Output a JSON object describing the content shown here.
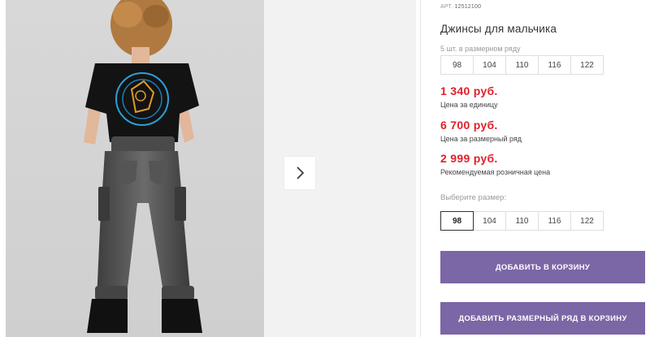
{
  "product": {
    "article_label": "АРТ.",
    "article_value": "12512100",
    "title": "Джинсы для мальчика",
    "size_set_hint": "5 шт. в размерном ряду",
    "size_set": [
      "98",
      "104",
      "110",
      "116",
      "122"
    ]
  },
  "prices": [
    {
      "value": "1 340 руб.",
      "label": "Цена за единицу"
    },
    {
      "value": "6 700 руб.",
      "label": "Цена за размерный ряд"
    },
    {
      "value": "2 999 руб.",
      "label": "Рекомендуемая розничная цена"
    }
  ],
  "size_picker": {
    "label": "Выберите размер:",
    "sizes": [
      "98",
      "104",
      "110",
      "116",
      "122"
    ],
    "selected": "98"
  },
  "actions": {
    "add_to_cart": "ДОБАВИТЬ В КОРЗИНУ",
    "add_size_set_to_cart": "ДОБАВИТЬ РАЗМЕРНЫЙ РЯД В КОРЗИНУ"
  },
  "gallery": {
    "next_icon": "chevron-right-icon"
  },
  "colors": {
    "price": "#e0202a",
    "button": "#7b66a6"
  }
}
